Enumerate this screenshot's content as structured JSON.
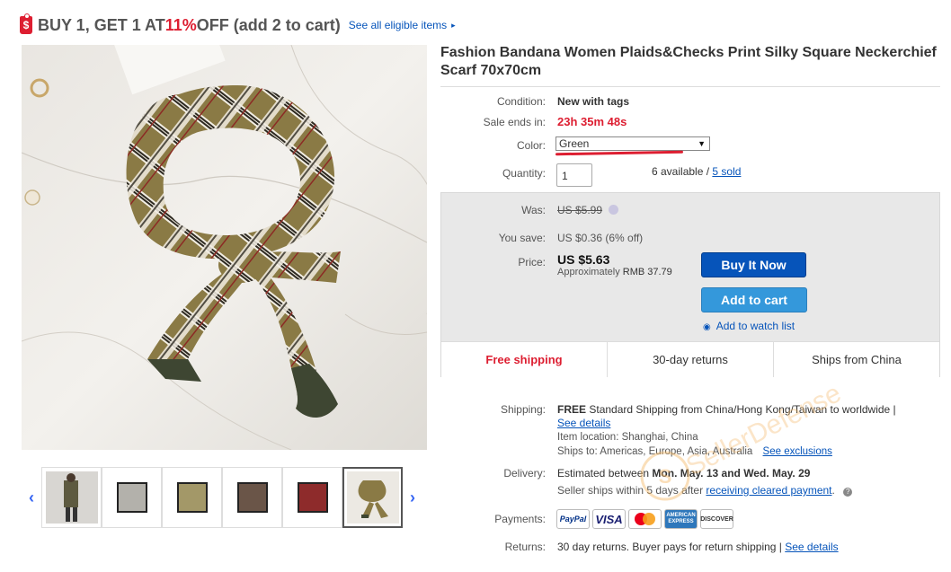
{
  "promo": {
    "badge_icon": "sale-tag-icon",
    "text_prefix": "BUY 1, GET 1 AT ",
    "percent": "11%",
    "text_suffix": " OFF (add 2 to cart)",
    "link": "See all eligible items",
    "link_arrow": "▸"
  },
  "gallery": {
    "prev": "‹",
    "next": "›",
    "thumbs": [
      {
        "name": "model",
        "color": "#6b6a4c"
      },
      {
        "name": "grey",
        "color": "#b3b1ab"
      },
      {
        "name": "khaki",
        "color": "#a39868"
      },
      {
        "name": "brown",
        "color": "#6a5548"
      },
      {
        "name": "red",
        "color": "#8e2b2b"
      },
      {
        "name": "green",
        "color": "#7d6b37",
        "active": true
      }
    ]
  },
  "item": {
    "title": "Fashion Bandana Women Plaids&Checks Print Silky Square Neckerchief Scarf 70x70cm",
    "condition_label": "Condition:",
    "condition": "New with tags",
    "sale_ends_label": "Sale ends in:",
    "sale_ends": "23h 35m 48s",
    "color_label": "Color:",
    "color_value": "Green",
    "quantity_label": "Quantity:",
    "quantity": "1",
    "available": "6 available / ",
    "sold": "5 sold"
  },
  "pricing": {
    "was_label": "Was:",
    "was": "US $5.99",
    "you_save_label": "You save:",
    "you_save": "US $0.36 (6% off)",
    "price_label": "Price:",
    "price": "US $5.63",
    "approx_prefix": "Approximately ",
    "approx": "RMB 37.79",
    "buy_now": "Buy It Now",
    "add_to_cart": "Add to cart",
    "watch": "Add to watch list",
    "badges": [
      "Free shipping",
      "30-day returns",
      "Ships from China"
    ]
  },
  "shipping": {
    "shipping_label": "Shipping:",
    "free": "FREE",
    "shipping_text": " Standard Shipping from China/Hong Kong/Taiwan to worldwide |",
    "see_details": "See details",
    "item_location": "Item location:  Shanghai, China",
    "ships_to": "Ships to:  Americas, Europe, Asia, Australia",
    "see_exclusions": "See exclusions",
    "delivery_label": "Delivery:",
    "delivery_prefix": "Estimated between ",
    "delivery_dates": "Mon. May. 13 and Wed. May. 29",
    "seller_ships": "Seller ships within 5 days after ",
    "cleared_payment": "receiving cleared payment",
    "payments_label": "Payments:",
    "cards": [
      "PayPal",
      "VISA",
      "MasterCard",
      "AMERICAN EXPRESS",
      "DISCOVER"
    ],
    "returns_label": "Returns:",
    "returns_text": "30 day returns. Buyer pays for return shipping | ",
    "returns_link": "See details"
  },
  "watermark": "SellerDefense",
  "colors": {
    "ebay_blue": "#0654ba",
    "sale_red": "#dd1e31",
    "button_light_blue": "#3498db"
  }
}
